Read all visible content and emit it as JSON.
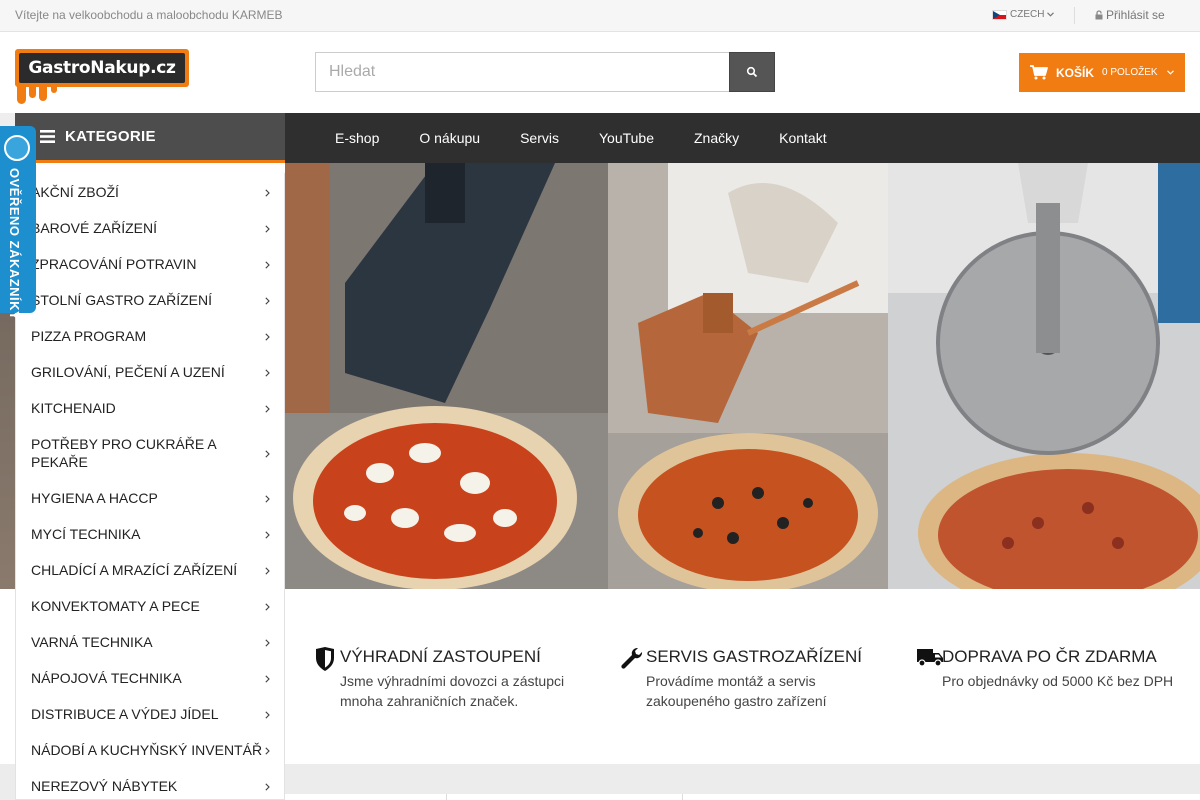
{
  "topbar": {
    "welcome": "Vítejte na velkoobchodu a maloobchodu KARMEB",
    "language": "CZECH",
    "login": "Přihlásit se"
  },
  "header": {
    "logo_text": "GastroNakup.cz",
    "search_placeholder": "Hledat",
    "cart_label": "KOŠÍK",
    "cart_count": "0 POLOŽEK"
  },
  "nav": {
    "categories_label": "KATEGORIE",
    "links": [
      "E-shop",
      "O nákupu",
      "Servis",
      "YouTube",
      "Značky",
      "Kontakt"
    ]
  },
  "categories": [
    "AKČNÍ ZBOŽÍ",
    "BAROVÉ ZAŘÍZENÍ",
    "ZPRACOVÁNÍ POTRAVIN",
    "STOLNÍ GASTRO ZAŘÍZENÍ",
    "PIZZA PROGRAM",
    "GRILOVÁNÍ, PEČENÍ A UZENÍ",
    "KITCHENAID",
    "POTŘEBY PRO CUKRÁŘE A PEKAŘE",
    "HYGIENA A HACCP",
    "MYCÍ TECHNIKA",
    "CHLADÍCÍ A MRAZÍCÍ ZAŘÍZENÍ",
    "KONVEKTOMATY A PECE",
    "VARNÁ TECHNIKA",
    "NÁPOJOVÁ TECHNIKA",
    "DISTRIBUCE A VÝDEJ JÍDEL",
    "NÁDOBÍ A KUCHYŇSKÝ INVENTÁŘ",
    "NEREZOVÝ NÁBYTEK"
  ],
  "badge": {
    "text": "OVĚŘENO ZÁKAZNÍKY"
  },
  "features": [
    {
      "icon": "shield-icon",
      "title": "VÝHRADNÍ ZASTOUPENÍ",
      "text": "Jsme výhradními dovozci a zástupci mnoha zahraničních značek."
    },
    {
      "icon": "wrench-icon",
      "title": "SERVIS GASTROZAŘÍZENÍ",
      "text": "Provádíme montáž a servis zakoupeného gastro zařízení"
    },
    {
      "icon": "truck-icon",
      "title": "DOPRAVA PO ČR ZDARMA",
      "text": "Pro objednávky od 5000 Kč bez DPH"
    }
  ],
  "colors": {
    "accent": "#f07c12",
    "navbar": "#2f2f2f",
    "badge": "#1d8fce"
  }
}
